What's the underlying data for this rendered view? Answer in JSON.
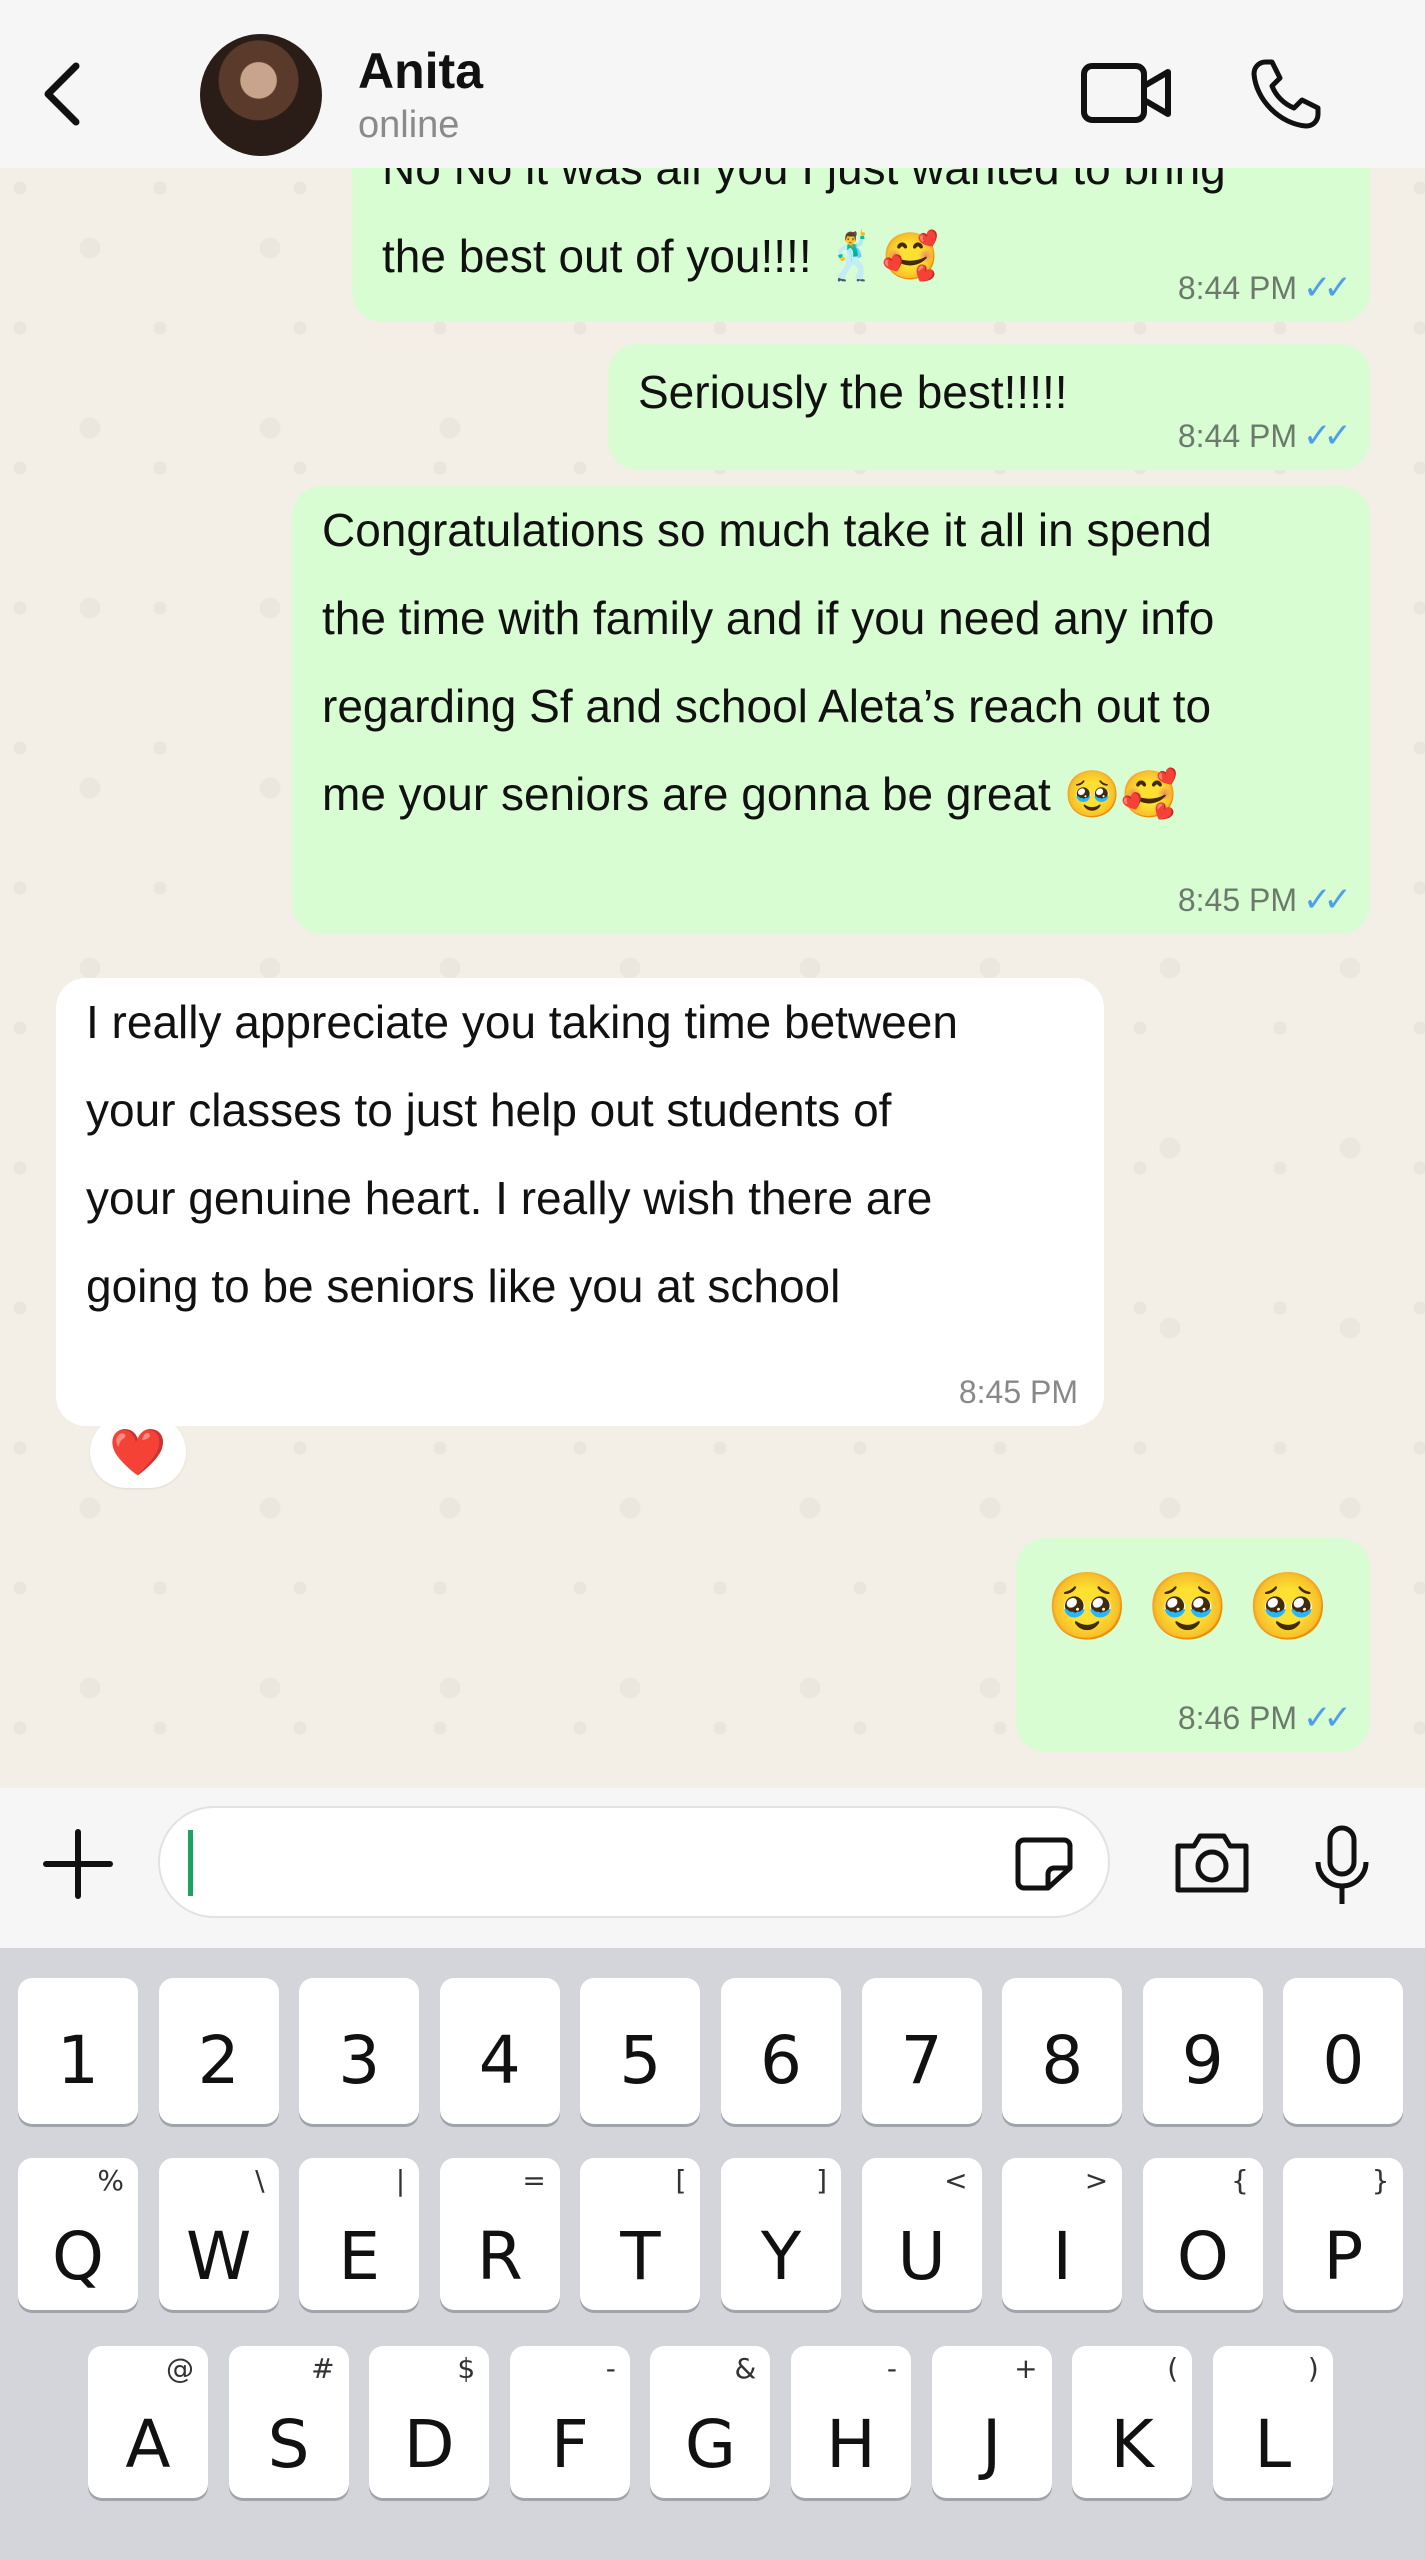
{
  "header": {
    "back_label": "‹",
    "name": "Anita",
    "status": "online"
  },
  "messages": [
    {
      "id": "m1",
      "dir": "out",
      "lines": [
        "No No it was all you I just wanted to bring",
        "the best out of you!!!! 🕺🥰"
      ],
      "time": "8:44 PM",
      "ticks": "✓✓"
    },
    {
      "id": "m2",
      "dir": "out",
      "lines": [
        "Seriously the best!!!!!"
      ],
      "time": "8:44 PM",
      "ticks": "✓✓"
    },
    {
      "id": "m3",
      "dir": "out",
      "lines": [
        "Congratulations so much take it all in spend",
        "the time with family and if you need any info",
        "regarding Sf and school Aleta’s reach out to",
        "me your seniors are gonna be great 🥹🥰"
      ],
      "time": "8:45 PM",
      "ticks": "✓✓"
    },
    {
      "id": "m4",
      "dir": "in",
      "lines": [
        "I really appreciate you taking time between",
        "your classes to just help out students of",
        "your genuine heart. I really wish there are",
        "going to be seniors like you at school"
      ],
      "time": "8:45 PM",
      "reaction": "❤️"
    },
    {
      "id": "m5",
      "dir": "out",
      "lines": [
        "🥹 🥹 🥹"
      ],
      "time": "8:46 PM",
      "ticks": "✓✓"
    }
  ],
  "composer": {
    "value": "",
    "plus_label": "+"
  },
  "keyboard": {
    "numbers": [
      "1",
      "2",
      "3",
      "4",
      "5",
      "6",
      "7",
      "8",
      "9",
      "0"
    ],
    "row1": [
      {
        "k": "Q",
        "s": "%"
      },
      {
        "k": "W",
        "s": "\\"
      },
      {
        "k": "E",
        "s": "|"
      },
      {
        "k": "R",
        "s": "="
      },
      {
        "k": "T",
        "s": "["
      },
      {
        "k": "Y",
        "s": "]"
      },
      {
        "k": "U",
        "s": "<"
      },
      {
        "k": "I",
        "s": ">"
      },
      {
        "k": "O",
        "s": "{"
      },
      {
        "k": "P",
        "s": "}"
      }
    ],
    "row2": [
      {
        "k": "A",
        "s": "@"
      },
      {
        "k": "S",
        "s": "#"
      },
      {
        "k": "D",
        "s": "$"
      },
      {
        "k": "F",
        "s": "-"
      },
      {
        "k": "G",
        "s": "&"
      },
      {
        "k": "H",
        "s": "-"
      },
      {
        "k": "J",
        "s": "+"
      },
      {
        "k": "K",
        "s": "("
      },
      {
        "k": "L",
        "s": ")"
      }
    ]
  },
  "colors": {
    "outgoing_bubble": "#d9fdd3",
    "incoming_bubble": "#ffffff",
    "read_ticks": "#4fa0e8",
    "caret": "#1aa260"
  }
}
